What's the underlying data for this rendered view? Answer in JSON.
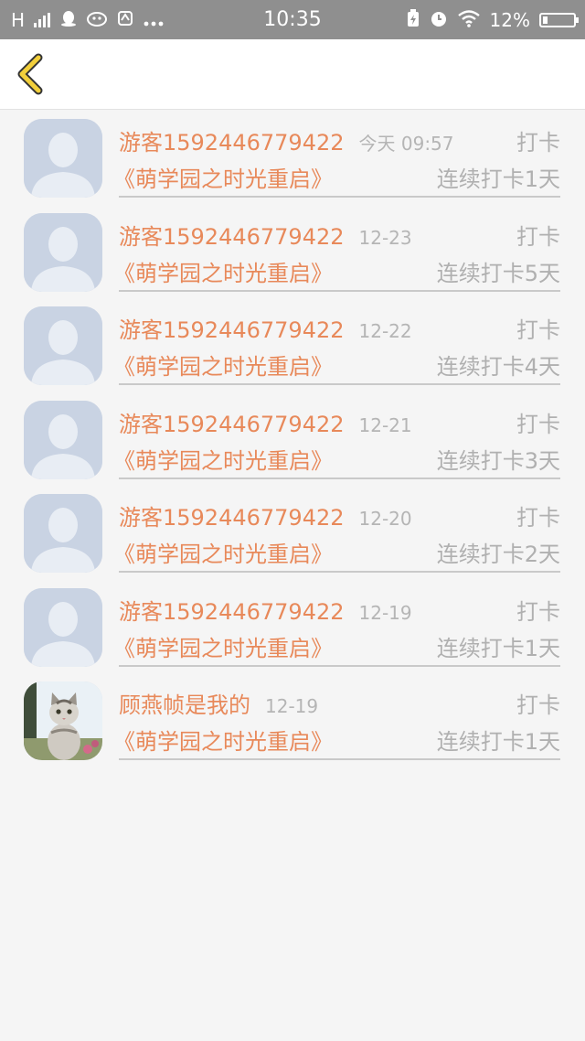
{
  "status_bar": {
    "time": "10:35",
    "battery": "12%",
    "network": "H",
    "icons": [
      "signal-icon",
      "qq-icon",
      "cat-app-icon",
      "sync-icon",
      "more-icon",
      "battery-saver-icon",
      "alarm-icon",
      "wifi-icon",
      "battery-icon"
    ]
  },
  "nav": {
    "back_icon": "chevron-left-icon",
    "accent_color": "#f2cf3b"
  },
  "colors": {
    "name_color": "#e8895a",
    "muted_color": "#b0b0b0"
  },
  "items": [
    {
      "user": "游客1592446779422",
      "date": "今天 09:57",
      "action": "打卡",
      "book": "《萌学园之时光重启》",
      "streak": "连续打卡1天",
      "avatar": "default-avatar"
    },
    {
      "user": "游客1592446779422",
      "date": "12-23",
      "action": "打卡",
      "book": "《萌学园之时光重启》",
      "streak": "连续打卡5天",
      "avatar": "default-avatar"
    },
    {
      "user": "游客1592446779422",
      "date": "12-22",
      "action": "打卡",
      "book": "《萌学园之时光重启》",
      "streak": "连续打卡4天",
      "avatar": "default-avatar"
    },
    {
      "user": "游客1592446779422",
      "date": "12-21",
      "action": "打卡",
      "book": "《萌学园之时光重启》",
      "streak": "连续打卡3天",
      "avatar": "default-avatar"
    },
    {
      "user": "游客1592446779422",
      "date": "12-20",
      "action": "打卡",
      "book": "《萌学园之时光重启》",
      "streak": "连续打卡2天",
      "avatar": "default-avatar"
    },
    {
      "user": "游客1592446779422",
      "date": "12-19",
      "action": "打卡",
      "book": "《萌学园之时光重启》",
      "streak": "连续打卡1天",
      "avatar": "default-avatar"
    },
    {
      "user": "顾燕帧是我的",
      "date": "12-19",
      "action": "打卡",
      "book": "《萌学园之时光重启》",
      "streak": "连续打卡1天",
      "avatar": "cat-photo-avatar"
    }
  ]
}
